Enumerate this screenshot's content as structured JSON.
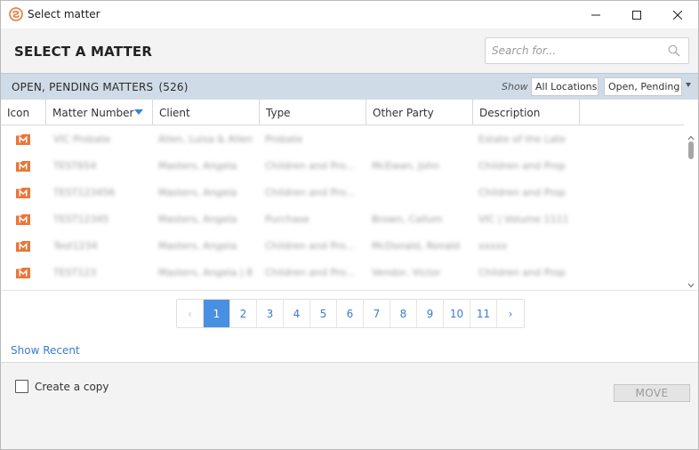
{
  "window": {
    "title": "Select matter"
  },
  "header": {
    "title": "SELECT A MATTER",
    "search_placeholder": "Search for..."
  },
  "section": {
    "title": "OPEN, PENDING MATTERS",
    "count": "(526)",
    "show_label": "Show",
    "location_filter": "All Locations",
    "status_filter": "Open, Pending"
  },
  "table": {
    "columns": [
      "Icon",
      "Matter Number",
      "Client",
      "Type",
      "Other Party",
      "Description"
    ],
    "sorted_column": "Matter Number",
    "rows": [
      {
        "matter_number": "VIC Probate",
        "client": "Allen, Luisa & Allen",
        "type": "Probate",
        "other_party": "",
        "description": "Estate of the Late"
      },
      {
        "matter_number": "TEST654",
        "client": "Masters, Angela",
        "type": "Children and Pro...",
        "other_party": "McEwan, John",
        "description": "Children and Prop"
      },
      {
        "matter_number": "TEST123456",
        "client": "Masters, Angela",
        "type": "Children and Pro...",
        "other_party": "",
        "description": "Children and Prop"
      },
      {
        "matter_number": "TEST12345",
        "client": "Masters, Angela",
        "type": "Purchase",
        "other_party": "Brown, Callum",
        "description": "VIC | Volume 1111"
      },
      {
        "matter_number": "Test1234",
        "client": "Masters, Angela",
        "type": "Children and Pro...",
        "other_party": "McDonald, Ronald",
        "description": "xxxxx"
      },
      {
        "matter_number": "TEST123",
        "client": "Masters, Angela | 8",
        "type": "Children and Pro...",
        "other_party": "Vendor, Victor",
        "description": "Children and Prop"
      }
    ]
  },
  "pagination": {
    "prev": "‹",
    "pages": [
      "1",
      "2",
      "3",
      "4",
      "5",
      "6",
      "7",
      "8",
      "9",
      "10",
      "11"
    ],
    "next": "›",
    "current": "1"
  },
  "links": {
    "show_recent": "Show Recent"
  },
  "footer": {
    "create_copy_label": "Create a copy",
    "move_label": "MOVE"
  },
  "colors": {
    "accent": "#4a90e2",
    "link": "#3a7bd5",
    "section_bar": "#cfdce8",
    "matter_icon": "#e8773a"
  },
  "icons": {
    "app": "app-logo-icon",
    "search": "search-icon",
    "matter": "matter-folder-icon",
    "minimize": "minimize-icon",
    "maximize": "maximize-icon",
    "close": "close-icon"
  }
}
